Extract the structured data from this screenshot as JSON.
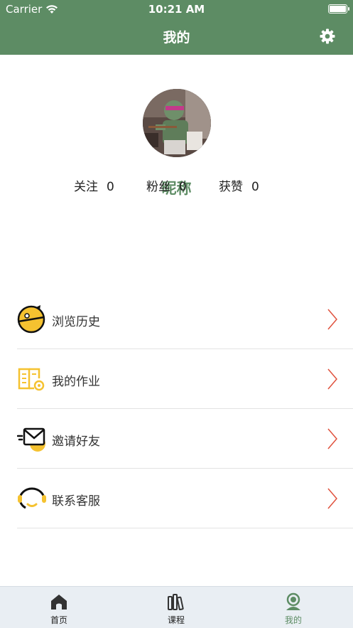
{
  "status_bar": {
    "carrier": "Carrier",
    "time": "10:21 AM"
  },
  "nav": {
    "title": "我的"
  },
  "profile": {
    "nickname": "昵称",
    "stats": [
      {
        "label": "关注",
        "value": "0"
      },
      {
        "label": "粉丝",
        "value": "0"
      },
      {
        "label": "获赞",
        "value": "0"
      }
    ]
  },
  "menu": {
    "items": [
      {
        "label": "浏览历史",
        "icon": "history-icon"
      },
      {
        "label": "我的作业",
        "icon": "homework-icon"
      },
      {
        "label": "邀请好友",
        "icon": "invite-mail-icon"
      },
      {
        "label": "联系客服",
        "icon": "headset-icon"
      }
    ]
  },
  "tabs": [
    {
      "label": "首页",
      "icon": "home-icon"
    },
    {
      "label": "课程",
      "icon": "books-icon"
    },
    {
      "label": "我的",
      "icon": "profile-icon",
      "active": true
    }
  ],
  "colors": {
    "primary": "#5d8c64",
    "accent_yellow": "#f5c230",
    "arrow_red": "#e0523e"
  }
}
